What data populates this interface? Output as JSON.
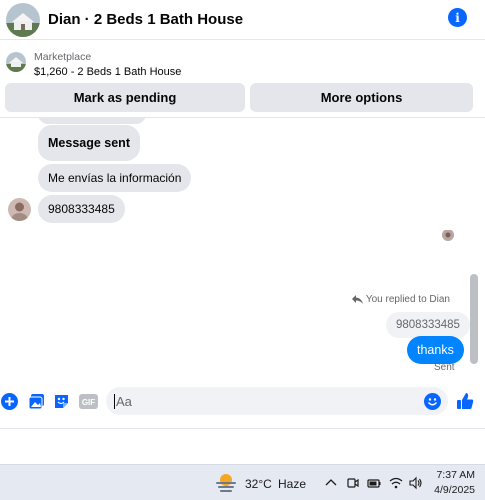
{
  "header": {
    "title": "Dian · 2 Beds 1 Bath House",
    "avatar": "house-avatar",
    "info_icon": "info-icon"
  },
  "marketplace": {
    "label": "Marketplace",
    "listing": "$1,260 - 2 Beds 1 Bath House",
    "mark_pending_label": "Mark as pending",
    "more_options_label": "More options"
  },
  "chat": {
    "messages": [
      {
        "direction": "in",
        "text": "Message sent"
      },
      {
        "direction": "in",
        "text": "Me envías la información"
      },
      {
        "direction": "in",
        "text": "9808333485"
      }
    ],
    "replied_label": "You replied to Dian",
    "quoted_reply": "9808333485",
    "outgoing": {
      "text": "thanks",
      "status": "Sent"
    }
  },
  "composer": {
    "placeholder": "Aa",
    "icons": [
      "plus-circle-icon",
      "photo-icon",
      "sticker-icon",
      "gif-icon",
      "emoji-icon",
      "like-icon"
    ],
    "gif_label": "GIF"
  },
  "taskbar": {
    "temperature": "32°C",
    "weather": "Haze",
    "time": "7:37 AM",
    "date": "4/9/2025",
    "tray_icons": [
      "chevron-up-icon",
      "meet-now-icon",
      "battery-icon",
      "wifi-icon",
      "speaker-icon"
    ]
  },
  "colors": {
    "accent": "#0866ff",
    "outgoing_bubble": "#0084ff",
    "incoming_bubble": "#e4e6eb",
    "button_bg": "#e4e6eb",
    "taskbar_bg": "#e5e9f2"
  }
}
